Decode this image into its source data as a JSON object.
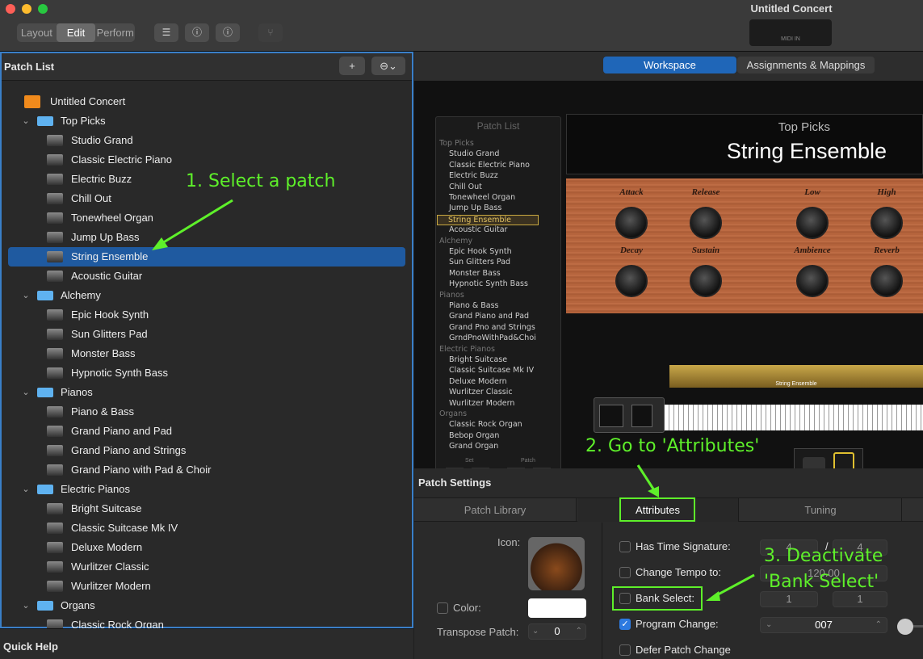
{
  "window": {
    "title": "Untitled Concert",
    "midi_label": "MIDI IN"
  },
  "toolbar": {
    "modes": [
      "Layout",
      "Edit",
      "Perform"
    ],
    "active_mode": "Edit",
    "list_icon": "list-icon",
    "info_icon": "info-icon",
    "help_icon": "help-icon",
    "tuning_icon": "tuning-fork-icon"
  },
  "patch_list": {
    "title": "Patch List",
    "add_label": "+",
    "more_label": "⊖⌄",
    "rows": [
      {
        "label": "Untitled Concert",
        "kind": "concert",
        "level": 0
      },
      {
        "label": "Top Picks",
        "kind": "folder",
        "level": 1
      },
      {
        "label": "Studio Grand",
        "kind": "patch",
        "level": 2
      },
      {
        "label": "Classic Electric Piano",
        "kind": "patch",
        "level": 2
      },
      {
        "label": "Electric Buzz",
        "kind": "patch",
        "level": 2
      },
      {
        "label": "Chill Out",
        "kind": "patch",
        "level": 2
      },
      {
        "label": "Tonewheel Organ",
        "kind": "patch",
        "level": 2
      },
      {
        "label": "Jump Up Bass",
        "kind": "patch",
        "level": 2
      },
      {
        "label": "String Ensemble",
        "kind": "patch",
        "level": 2,
        "selected": true
      },
      {
        "label": "Acoustic Guitar",
        "kind": "patch",
        "level": 2
      },
      {
        "label": "Alchemy",
        "kind": "folder",
        "level": 1
      },
      {
        "label": "Epic Hook Synth",
        "kind": "patch",
        "level": 2
      },
      {
        "label": "Sun Glitters Pad",
        "kind": "patch",
        "level": 2
      },
      {
        "label": "Monster Bass",
        "kind": "patch",
        "level": 2
      },
      {
        "label": "Hypnotic Synth Bass",
        "kind": "patch",
        "level": 2
      },
      {
        "label": "Pianos",
        "kind": "folder",
        "level": 1
      },
      {
        "label": "Piano & Bass",
        "kind": "patch",
        "level": 2
      },
      {
        "label": "Grand Piano and Pad",
        "kind": "patch",
        "level": 2
      },
      {
        "label": "Grand Piano and Strings",
        "kind": "patch",
        "level": 2
      },
      {
        "label": "Grand Piano with Pad & Choir",
        "kind": "patch",
        "level": 2
      },
      {
        "label": "Electric Pianos",
        "kind": "folder",
        "level": 1
      },
      {
        "label": "Bright Suitcase",
        "kind": "patch",
        "level": 2
      },
      {
        "label": "Classic Suitcase Mk IV",
        "kind": "patch",
        "level": 2
      },
      {
        "label": "Deluxe Modern",
        "kind": "patch",
        "level": 2
      },
      {
        "label": "Wurlitzer Classic",
        "kind": "patch",
        "level": 2
      },
      {
        "label": "Wurlitzer Modern",
        "kind": "patch",
        "level": 2
      },
      {
        "label": "Organs",
        "kind": "folder",
        "level": 1
      },
      {
        "label": "Classic Rock Organ",
        "kind": "patch",
        "level": 2
      }
    ]
  },
  "quick_help": {
    "title": "Quick Help"
  },
  "tabs": {
    "workspace": "Workspace",
    "assignments": "Assignments & Mappings"
  },
  "mini_list": {
    "title": "Patch List",
    "set_label": "Set",
    "patch_label": "Patch",
    "items": [
      {
        "t": "Top Picks",
        "g": true
      },
      {
        "t": "Studio Grand"
      },
      {
        "t": "Classic Electric Piano"
      },
      {
        "t": "Electric Buzz"
      },
      {
        "t": "Chill Out"
      },
      {
        "t": "Tonewheel Organ"
      },
      {
        "t": "Jump Up Bass"
      },
      {
        "t": "String Ensemble",
        "s": true
      },
      {
        "t": "Acoustic Guitar"
      },
      {
        "t": "Alchemy",
        "g": true
      },
      {
        "t": "Epic Hook Synth"
      },
      {
        "t": "Sun Glitters Pad"
      },
      {
        "t": "Monster Bass"
      },
      {
        "t": "Hypnotic Synth Bass"
      },
      {
        "t": "Pianos",
        "g": true
      },
      {
        "t": "Piano & Bass"
      },
      {
        "t": "Grand Piano and Pad"
      },
      {
        "t": "Grand Pno and Strings"
      },
      {
        "t": "GrndPnoWithPad&Choi"
      },
      {
        "t": "Electric Pianos",
        "g": true
      },
      {
        "t": "Bright Suitcase"
      },
      {
        "t": "Classic Suitcase Mk IV"
      },
      {
        "t": "Deluxe Modern"
      },
      {
        "t": "Wurlitzer Classic"
      },
      {
        "t": "Wurlitzer Modern"
      },
      {
        "t": "Organs",
        "g": true
      },
      {
        "t": "Classic Rock Organ"
      },
      {
        "t": "Bebop Organ"
      },
      {
        "t": "Grand Organ"
      }
    ]
  },
  "display": {
    "category": "Top Picks",
    "patch": "String Ensemble",
    "strip_label": "String Ensemble"
  },
  "knobs": [
    "Attack",
    "Release",
    "Low",
    "High",
    "Decay",
    "Sustain",
    "Ambience",
    "Reverb"
  ],
  "patch_settings": {
    "title": "Patch Settings",
    "tabs": [
      "Patch Library",
      "Attributes",
      "Tuning"
    ],
    "active_tab": "Attributes",
    "icon_label": "Icon:",
    "color_label": "Color:",
    "transpose_label": "Transpose Patch:",
    "transpose_value": "0",
    "has_time_signature": {
      "label": "Has Time Signature:",
      "checked": false,
      "num": "4",
      "den": "4",
      "sep": "/"
    },
    "change_tempo": {
      "label": "Change Tempo to:",
      "checked": false,
      "value": "120.00"
    },
    "bank_select": {
      "label": "Bank Select:",
      "checked": false,
      "msb": "1",
      "lsb": "1"
    },
    "program_change": {
      "label": "Program Change:",
      "checked": true,
      "value": "007"
    },
    "defer": {
      "label": "Defer Patch Change",
      "checked": false
    }
  },
  "annotations": {
    "step1": "1. Select a patch",
    "step2": "2. Go to 'Attributes'",
    "step3a": "3. Deactivate",
    "step3b": "'Bank Select'",
    "accent": "#5ef02a"
  }
}
